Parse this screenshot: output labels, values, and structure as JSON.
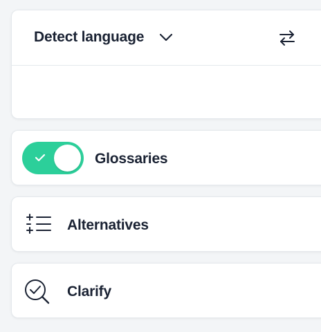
{
  "language_panel": {
    "source_language": "Detect language",
    "dropdown_icon": "chevron-down-icon",
    "swap_icon": "swap-arrows-icon"
  },
  "glossaries": {
    "label": "Glossaries",
    "enabled": true,
    "color": "#2ccf9a",
    "icon": "check-icon"
  },
  "alternatives": {
    "label": "Alternatives",
    "icon": "list-sparkle-icon"
  },
  "clarify": {
    "label": "Clarify",
    "icon": "magnifier-check-icon"
  }
}
